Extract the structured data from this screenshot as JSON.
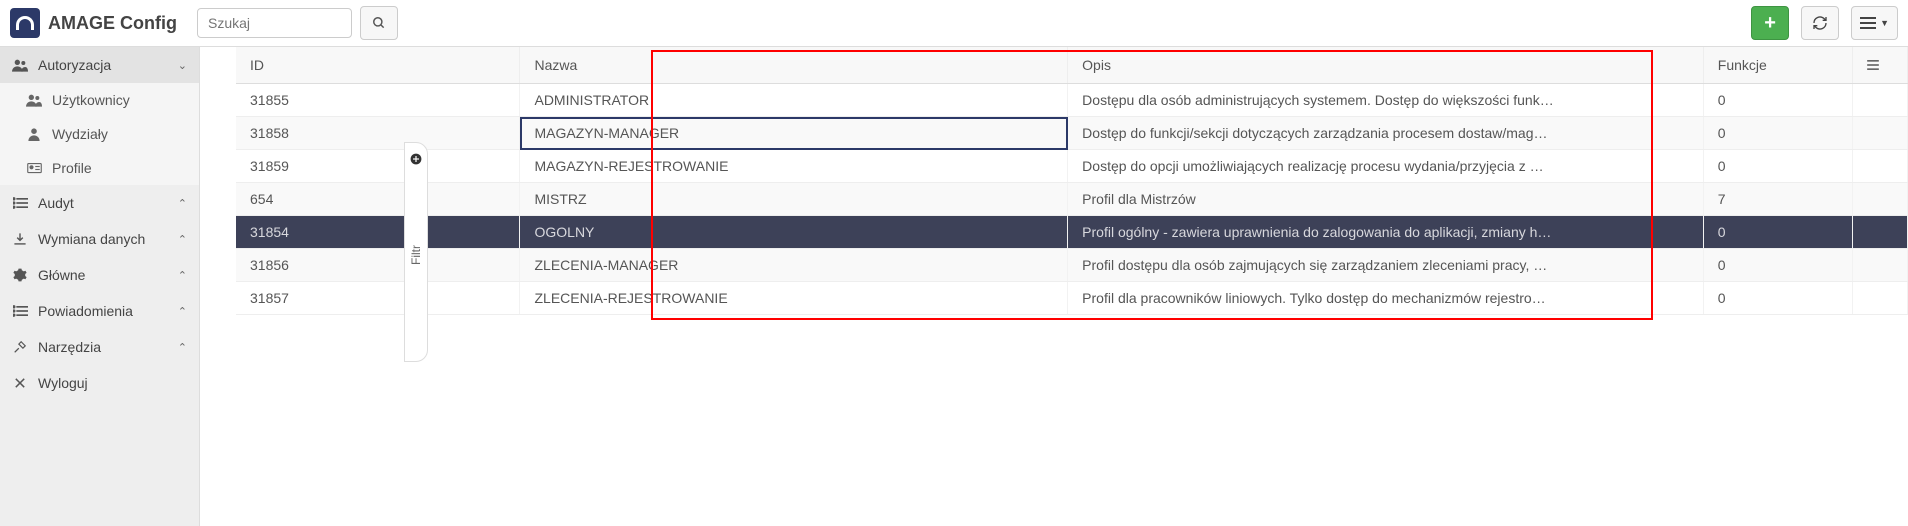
{
  "header": {
    "app_title": "AMAGE Config",
    "search_placeholder": "Szukaj"
  },
  "sidebar": {
    "sections": [
      {
        "key": "autoryzacja",
        "label": "Autoryzacja",
        "expanded": true,
        "children": [
          {
            "key": "uzytkownicy",
            "label": "Użytkownicy"
          },
          {
            "key": "wydzialy",
            "label": "Wydziały"
          },
          {
            "key": "profile",
            "label": "Profile"
          }
        ]
      },
      {
        "key": "audyt",
        "label": "Audyt",
        "expanded": false
      },
      {
        "key": "wymiana",
        "label": "Wymiana danych",
        "expanded": false
      },
      {
        "key": "glowne",
        "label": "Główne",
        "expanded": false
      },
      {
        "key": "powiadomienia",
        "label": "Powiadomienia",
        "expanded": false
      },
      {
        "key": "narzedzia",
        "label": "Narzędzia",
        "expanded": false
      },
      {
        "key": "wyloguj",
        "label": "Wyloguj",
        "expanded": null
      }
    ]
  },
  "filter": {
    "label": "Filtr"
  },
  "table": {
    "headers": {
      "id": "ID",
      "name": "Nazwa",
      "desc": "Opis",
      "func": "Funkcje"
    },
    "rows": [
      {
        "id": "31855",
        "name": "ADMINISTRATOR",
        "desc": "Dostępu dla osób administrujących systemem. Dostęp do większości funk…",
        "func": "0"
      },
      {
        "id": "31858",
        "name": "MAGAZYN-MANAGER",
        "desc": "Dostęp do funkcji/sekcji dotyczących zarządzania procesem dostaw/mag…",
        "func": "0"
      },
      {
        "id": "31859",
        "name": "MAGAZYN-REJESTROWANIE",
        "desc": "Dostęp do opcji umożliwiających realizację procesu wydania/przyjęcia z …",
        "func": "0"
      },
      {
        "id": "654",
        "name": "MISTRZ",
        "desc": "Profil dla Mistrzów",
        "func": "7"
      },
      {
        "id": "31854",
        "name": "OGOLNY",
        "desc": "Profil ogólny - zawiera uprawnienia do zalogowania do aplikacji, zmiany h…",
        "func": "0"
      },
      {
        "id": "31856",
        "name": "ZLECENIA-MANAGER",
        "desc": "Profil dostępu dla osób zajmujących się zarządzaniem zleceniami pracy, …",
        "func": "0"
      },
      {
        "id": "31857",
        "name": "ZLECENIA-REJESTROWANIE",
        "desc": "Profil dla pracowników liniowych. Tylko dostęp do mechanizmów rejestro…",
        "func": "0"
      }
    ],
    "selectedIndex": 4,
    "focusedCell": {
      "row": 1,
      "col": "name"
    }
  }
}
